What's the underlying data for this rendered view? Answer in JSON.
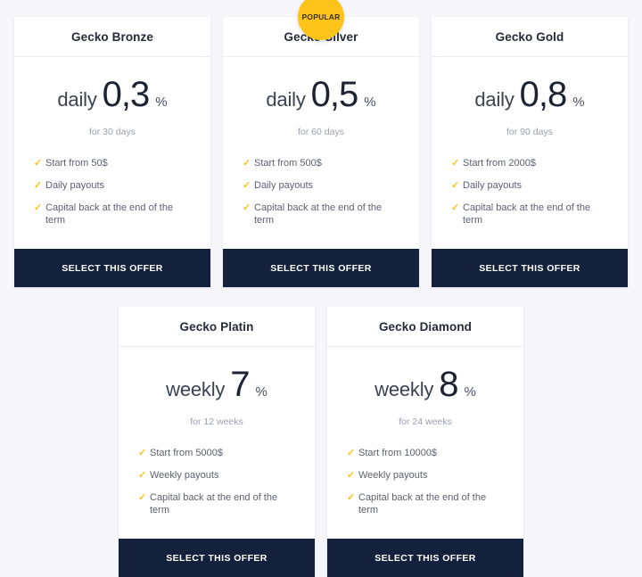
{
  "theme": {
    "page_background": "#f7f7fb",
    "card_background": "#ffffff",
    "cta_background": "#14213d",
    "accent_amber": "#fcc419",
    "title_color": "#242b39"
  },
  "common": {
    "cta_label": "SELECT THIS OFFER",
    "percent_symbol": "%",
    "check_glyph": "✓"
  },
  "rows": [
    {
      "name": "top-row",
      "cards": [
        {
          "id": "gecko-bronze",
          "title": "Gecko Bronze",
          "period": "daily",
          "value": "0,3",
          "percent": "%",
          "duration": "for 30 days",
          "badge": null,
          "features": [
            "Start from 50$",
            "Daily payouts",
            "Capital back at the end of the term"
          ],
          "cta_label": "SELECT THIS OFFER"
        },
        {
          "id": "gecko-silver",
          "title": "Gecko Silver",
          "period": "daily",
          "value": "0,5",
          "percent": "%",
          "duration": "for 60 days",
          "badge": "POPULAR",
          "features": [
            "Start from 500$",
            "Daily payouts",
            "Capital back at the end of the term"
          ],
          "cta_label": "SELECT THIS OFFER"
        },
        {
          "id": "gecko-gold",
          "title": "Gecko Gold",
          "period": "daily",
          "value": "0,8",
          "percent": "%",
          "duration": "for 90 days",
          "badge": null,
          "features": [
            "Start from 2000$",
            "Daily payouts",
            "Capital back at the end of the term"
          ],
          "cta_label": "SELECT THIS OFFER"
        }
      ]
    },
    {
      "name": "bottom-row",
      "cards": [
        {
          "id": "gecko-platin",
          "title": "Gecko Platin",
          "period": "weekly",
          "value": "7",
          "percent": "%",
          "duration": "for 12 weeks",
          "badge": null,
          "features": [
            "Start from 5000$",
            "Weekly payouts",
            "Capital back at the end of the term"
          ],
          "cta_label": "SELECT THIS OFFER"
        },
        {
          "id": "gecko-diamond",
          "title": "Gecko Diamond",
          "period": "weekly",
          "value": "8",
          "percent": "%",
          "duration": "for 24 weeks",
          "badge": null,
          "features": [
            "Start from 10000$",
            "Weekly payouts",
            "Capital back at the end of the term"
          ],
          "cta_label": "SELECT THIS OFFER"
        }
      ]
    }
  ]
}
